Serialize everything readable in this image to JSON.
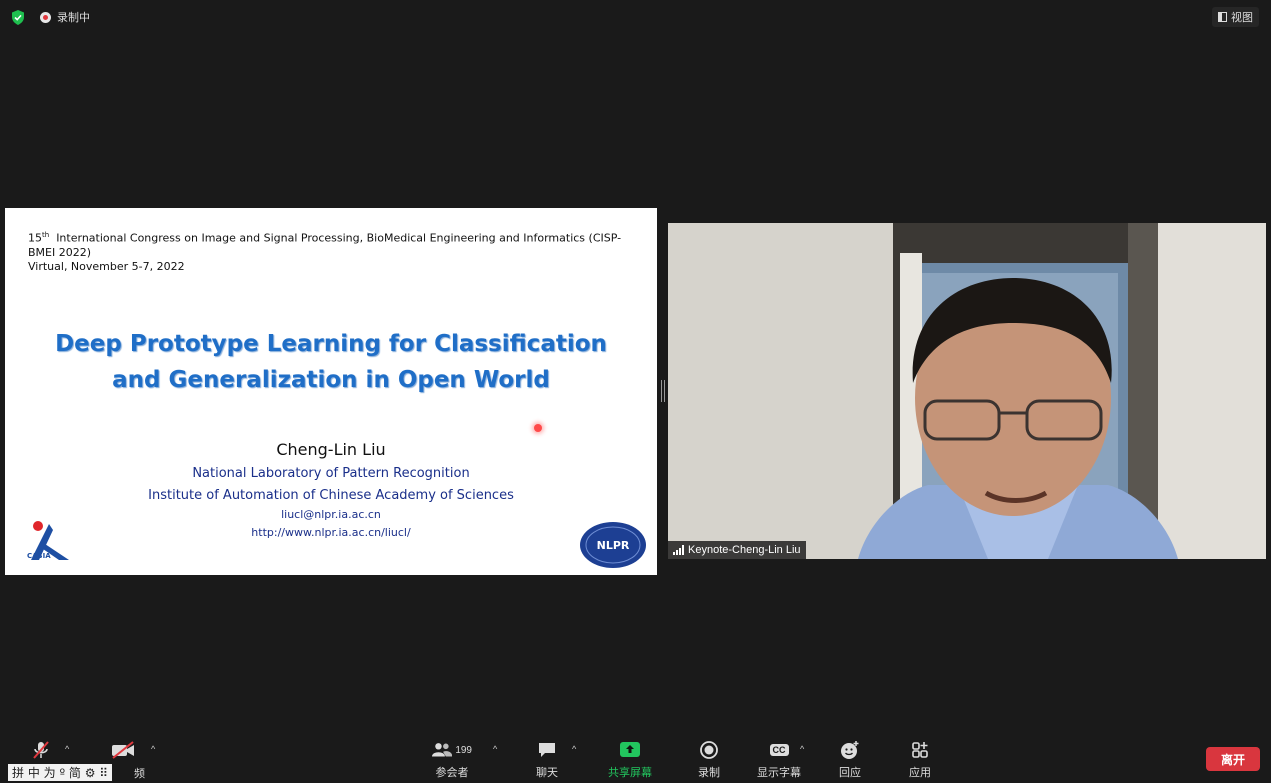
{
  "topbar": {
    "recording_label": "录制中",
    "view_label": "视图"
  },
  "slide": {
    "conf_ordinal": "15",
    "conf_sup": "th",
    "conf_line1": "International Congress on Image and Signal Processing, BioMedical Engineering and  Informatics (CISP-BMEI 2022)",
    "conf_line2": "Virtual, November 5-7, 2022",
    "title_line1": "Deep Prototype Learning for Classification",
    "title_line2": "and Generalization in Open World",
    "author": "Cheng-Lin Liu",
    "affiliation1": "National Laboratory of Pattern Recognition",
    "affiliation2": "Institute of Automation of Chinese Academy of Sciences",
    "email": "liucl@nlpr.ia.ac.cn",
    "url": "http://www.nlpr.ia.ac.cn/liucl/",
    "logo_left_text": "CASIA",
    "logo_right_text": "NLPR"
  },
  "video": {
    "participant_name": "Keynote-Cheng-Lin Liu"
  },
  "toolbar": {
    "participants_count": "199",
    "participants_label": "参会者",
    "chat_label": "聊天",
    "share_label": "共享屏幕",
    "record_label": "录制",
    "captions_label": "显示字幕",
    "captions_icon_text": "CC",
    "reactions_label": "回应",
    "apps_label": "应用",
    "leave_label": "离开",
    "video_label_partial": "频"
  },
  "ime": {
    "chars": "拼 中 为 º 简 ⚙ ⠿"
  },
  "colors": {
    "slide_title": "#1f6ec7",
    "slide_affiliation": "#1a2f8a",
    "share_green": "#22c55e",
    "leave_red": "#d9363e",
    "shield_green": "#1fbf4f"
  }
}
